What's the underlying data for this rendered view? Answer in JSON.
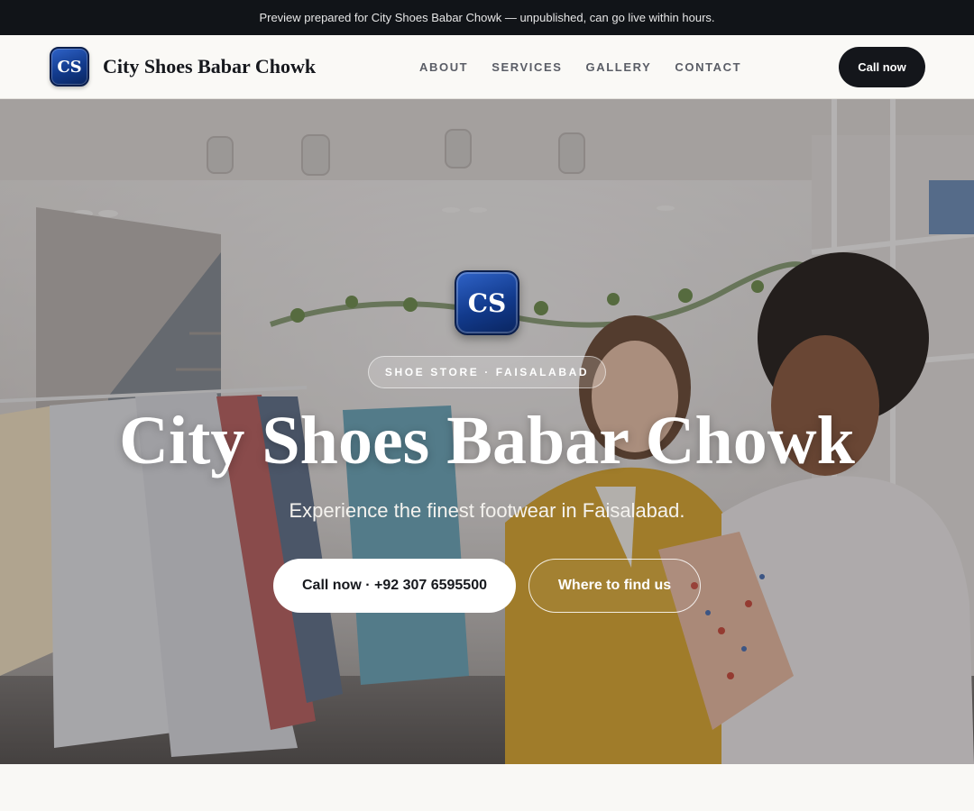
{
  "preview_banner": {
    "text": "Preview prepared for City Shoes Babar Chowk — unpublished, can go live within hours."
  },
  "navbar": {
    "logo_initials": "CS",
    "brand_name": "City Shoes Babar Chowk",
    "links": [
      {
        "label": "ABOUT"
      },
      {
        "label": "SERVICES"
      },
      {
        "label": "GALLERY"
      },
      {
        "label": "CONTACT"
      }
    ],
    "cta_label": "Call now"
  },
  "hero": {
    "logo_initials": "CS",
    "tag": "SHOE STORE · FAISALABAD",
    "title": "City Shoes Babar Chowk",
    "subtitle": "Experience the finest footwear in Faisalabad.",
    "primary_button": "Call now · +92 307 6595500",
    "secondary_button": "Where to find us",
    "background_image": "photo of two women browsing clothing racks in a bright boutique"
  },
  "colors": {
    "banner_bg": "#111418",
    "nav_bg": "#faf9f6",
    "cta_bg": "#14161b",
    "logo_blue": "#123a8c",
    "blazer_yellow": "#d9a730"
  }
}
